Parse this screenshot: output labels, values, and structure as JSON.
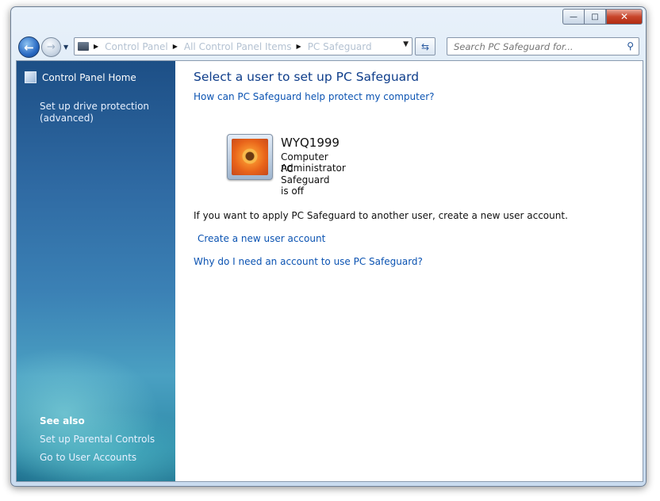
{
  "window": {
    "caption_buttons": {
      "minimize": "—",
      "maximize": "□",
      "close": "✕"
    }
  },
  "toolbar": {
    "back_icon": "back-arrow-icon",
    "forward_icon": "forward-arrow-icon",
    "breadcrumbs": [
      "Control Panel",
      "All Control Panel Items",
      "PC Safeguard"
    ],
    "search_placeholder": "Search PC Safeguard for...",
    "refresh_icon": "refresh-icon",
    "search_icon": "magnifier-icon"
  },
  "sidebar": {
    "home": "Control Panel Home",
    "drive_protection": "Set up drive protection (advanced)",
    "see_also": "See also",
    "parental_controls": "Set up Parental Controls",
    "user_accounts": "Go to User Accounts"
  },
  "main": {
    "title": "Select a user to set up PC Safeguard",
    "help_link": "How can PC Safeguard help protect my computer?",
    "user": {
      "name": "WYQ1999",
      "role": "Computer Administrator",
      "status": "PC Safeguard is off"
    },
    "info": "If you want to apply PC Safeguard to another user, create a new user account.",
    "create_link": "Create a new user account",
    "why_link": "Why do I need an account to use PC Safeguard?"
  },
  "colors": {
    "link": "#0b53b2",
    "title": "#0e3d8a",
    "sidebar_top": "#1d4f86",
    "sidebar_bottom": "#1d6d8c"
  }
}
